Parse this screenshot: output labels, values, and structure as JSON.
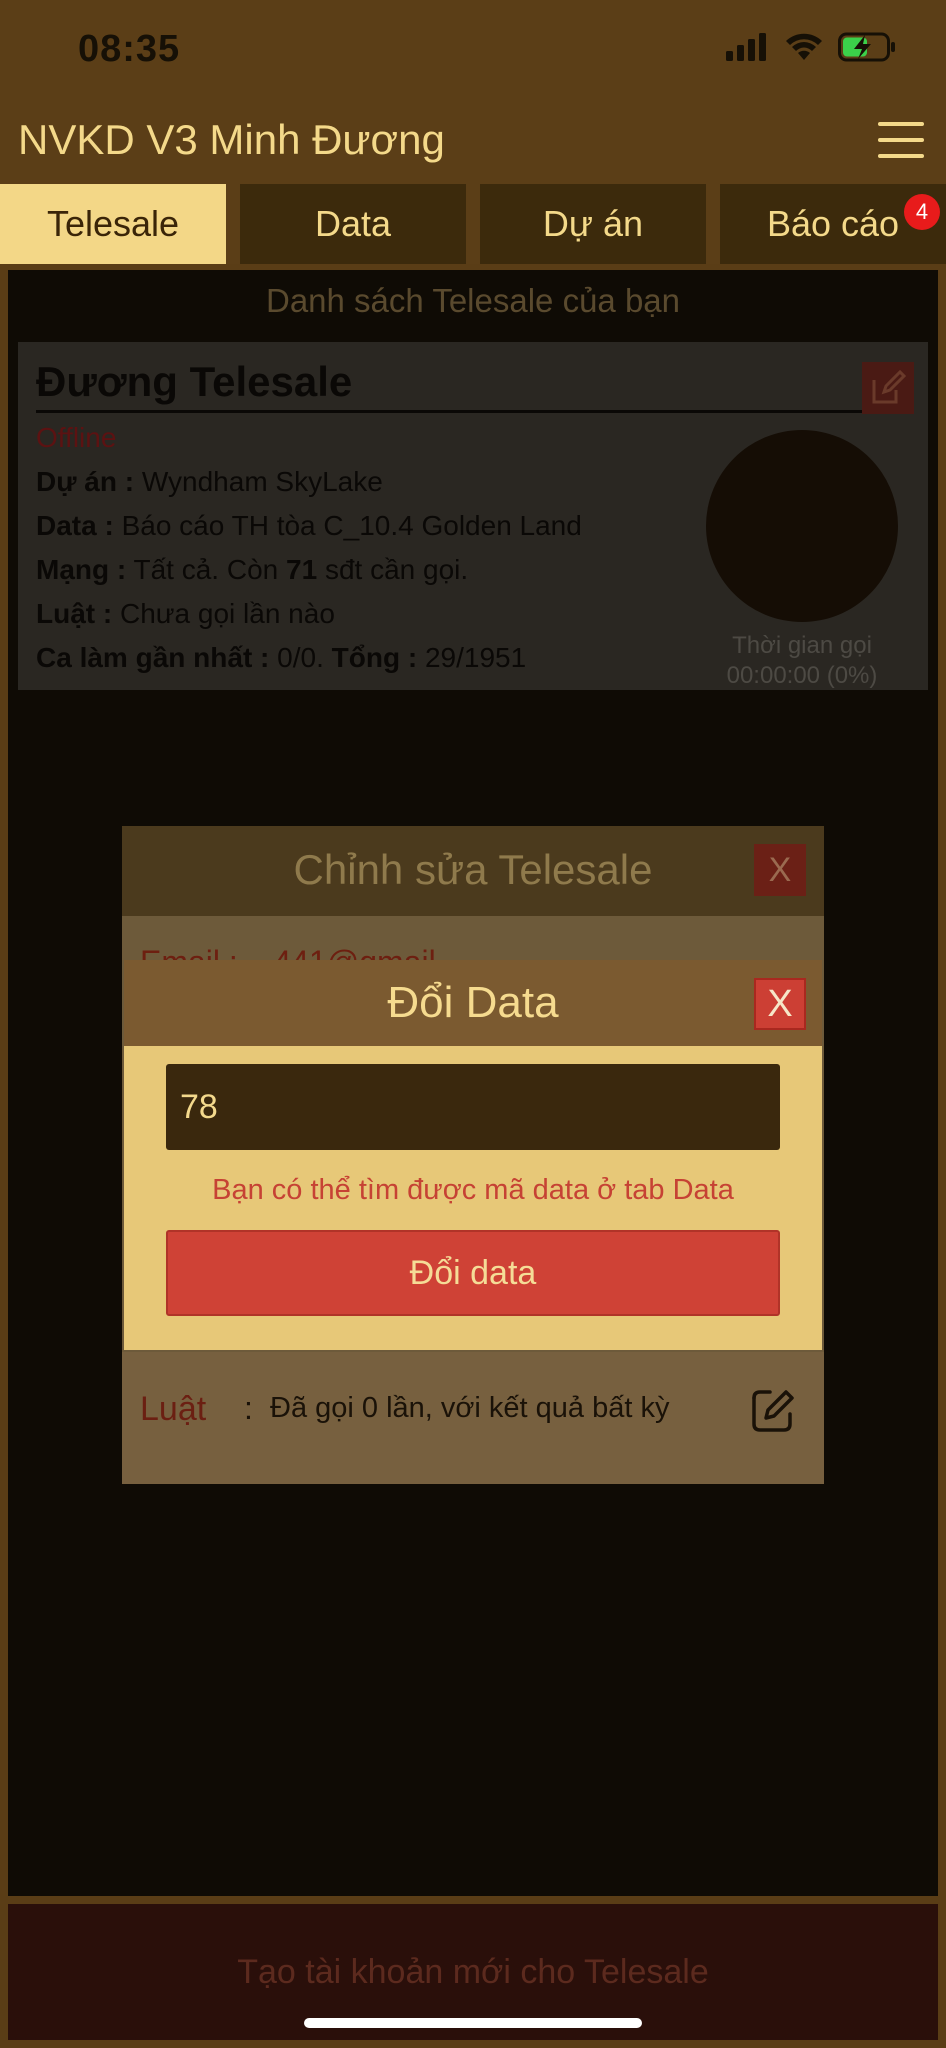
{
  "status_bar": {
    "time": "08:35"
  },
  "app": {
    "title": "NVKD V3 Minh Đương"
  },
  "tabs": [
    {
      "label": "Telesale",
      "active": true
    },
    {
      "label": "Data"
    },
    {
      "label": "Dự án"
    },
    {
      "label": "Báo cáo",
      "badge": "4"
    }
  ],
  "list": {
    "heading": "Danh sách Telesale của bạn",
    "card": {
      "name": "Đương Telesale",
      "status": "Offline",
      "project_label": "Dự án :",
      "project_value": "Wyndham SkyLake",
      "data_label": "Data :",
      "data_value": "Báo cáo TH tòa C_10.4 Golden Land",
      "network_label": "Mạng :",
      "network_value_prefix": "Tất cả. Còn",
      "network_count": "71",
      "network_value_suffix": "sđt cần gọi.",
      "law_label": "Luật :",
      "law_value": "Chưa gọi lần nào",
      "shift_label": "Ca làm gần nhất :",
      "shift_value": "0/0.",
      "total_label": "Tổng :",
      "total_value": "29/1951",
      "call_time_label": "Thời gian gọi",
      "call_time_value": "00:00:00 (0%)"
    }
  },
  "create_button": "Tạo tài khoản mới cho Telesale",
  "edit_modal": {
    "title": "Chỉnh sửa Telesale",
    "close": "X",
    "email_peek": "Email : ...441@gmail.",
    "law_label": "Luật",
    "law_colon": ":",
    "law_value": "Đã gọi 0 lần, với kết quả bất kỳ"
  },
  "change_data_modal": {
    "title": "Đổi Data",
    "close": "X",
    "input_value": "78",
    "hint": "Bạn có thể tìm được mã data ở tab Data",
    "submit": "Đổi data"
  },
  "colors": {
    "header_bg": "#5b3e17",
    "accent": "#f3d787",
    "danger": "#cf4236"
  }
}
